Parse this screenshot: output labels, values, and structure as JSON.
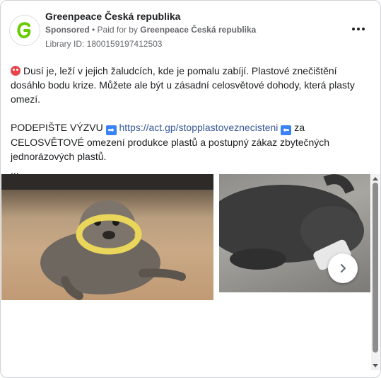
{
  "header": {
    "page_name": "Greenpeace Česká republika",
    "sponsored": "Sponsored",
    "separator": " • ",
    "paid_for_prefix": "Paid for by ",
    "paid_for_name": "Greenpeace Česká republika",
    "library_id": "Library ID: 1800159197412503",
    "more_icon": "more-horizontal-icon"
  },
  "post": {
    "paragraph1": "Dusí je, leží v jejich žaludcích, kde je pomalu zabíjí. Plastové znečištění dosáhlo bodu krize. Můžete ale být u zásadní celosvětové dohody, která plasty omezí.",
    "cta_prefix": "PODEPIŠTE VÝZVU",
    "link": "https://act.gp/stopplastoveznecisteni",
    "cta_suffix": "za CELOSVĚTOVÉ omezení produkce plastů a postupný zákaz zbytečných jednorázových plastů.",
    "ellipsis": "...",
    "emoji_start": "angry-face-icon",
    "arrow_right": "➡",
    "arrow_left": "⬅"
  },
  "carousel": {
    "images": [
      {
        "name": "seal-with-plastic-ring-on-beach"
      },
      {
        "name": "seal-with-plastic-cup-on-rocks"
      }
    ],
    "next_icon": "chevron-right-icon"
  },
  "colors": {
    "link": "#385898",
    "secondary_text": "#65676b",
    "logo_green": "#66cc00"
  }
}
